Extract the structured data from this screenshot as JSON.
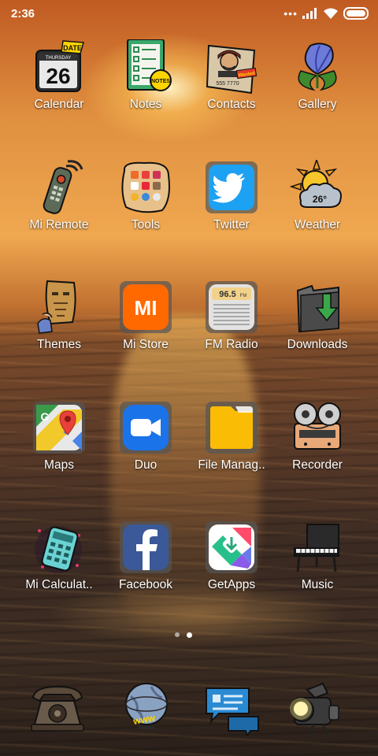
{
  "status_bar": {
    "time": "2:36",
    "signal_dots": "•••",
    "icons": [
      "signal-icon",
      "wifi-icon",
      "battery-icon"
    ]
  },
  "apps": [
    {
      "label": "Calendar",
      "icon": "calendar-icon",
      "calendar_day_name": "THURSDAY",
      "calendar_day": "26",
      "calendar_badge": "DATE"
    },
    {
      "label": "Notes",
      "icon": "notes-icon",
      "notes_badge": "NOTES"
    },
    {
      "label": "Contacts",
      "icon": "contacts-icon",
      "contacts_digits": "555 7770",
      "contacts_tag": "Wanted"
    },
    {
      "label": "Gallery",
      "icon": "gallery-icon"
    },
    {
      "label": "Mi Remote",
      "icon": "remote-icon"
    },
    {
      "label": "Tools",
      "icon": "tools-icon"
    },
    {
      "label": "Twitter",
      "icon": "twitter-icon"
    },
    {
      "label": "Weather",
      "icon": "weather-icon",
      "temperature": "26°"
    },
    {
      "label": "Themes",
      "icon": "themes-icon"
    },
    {
      "label": "Mi Store",
      "icon": "mi-store-icon",
      "logo_text": "MI"
    },
    {
      "label": "FM Radio",
      "icon": "radio-icon",
      "frequency": "96.5",
      "freq_unit": "FM"
    },
    {
      "label": "Downloads",
      "icon": "downloads-icon"
    },
    {
      "label": "Maps",
      "icon": "maps-icon"
    },
    {
      "label": "Duo",
      "icon": "duo-icon"
    },
    {
      "label": "File Manag..",
      "icon": "folder-icon"
    },
    {
      "label": "Recorder",
      "icon": "recorder-icon"
    },
    {
      "label": "Mi Calculat..",
      "icon": "calculator-icon"
    },
    {
      "label": "Facebook",
      "icon": "facebook-icon"
    },
    {
      "label": "GetApps",
      "icon": "getapps-icon"
    },
    {
      "label": "Music",
      "icon": "piano-icon"
    }
  ],
  "page_indicator": {
    "pages": 2,
    "active_index": 1
  },
  "dock": [
    {
      "icon": "phone-icon"
    },
    {
      "icon": "browser-icon",
      "text": "www"
    },
    {
      "icon": "messages-icon"
    },
    {
      "icon": "camera-icon"
    }
  ],
  "colors": {
    "twitter": "#1da1f2",
    "mi_store": "#ff6900",
    "duo": "#1a73e8",
    "file_manager": "#fbbc05",
    "facebook": "#3b5998"
  }
}
